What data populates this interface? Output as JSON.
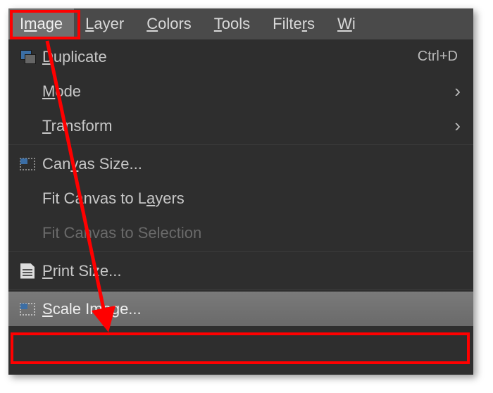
{
  "menubar": {
    "image": {
      "pre": "I",
      "ul": "m",
      "post": "age"
    },
    "layer": {
      "pre": "",
      "ul": "L",
      "post": "ayer"
    },
    "colors": {
      "pre": "",
      "ul": "C",
      "post": "olors"
    },
    "tools": {
      "pre": "",
      "ul": "T",
      "post": "ools"
    },
    "filters": {
      "pre": "Filte",
      "ul": "r",
      "post": "s"
    },
    "windows": {
      "pre": "",
      "ul": "W",
      "post": "i"
    }
  },
  "menu": {
    "duplicate": {
      "pre": "",
      "ul": "D",
      "post": "uplicate",
      "accel": "Ctrl+D"
    },
    "mode": {
      "pre": "",
      "ul": "M",
      "post": "ode"
    },
    "transform": {
      "pre": "",
      "ul": "T",
      "post": "ransform"
    },
    "canvas_size": {
      "pre": "Can",
      "ul": "v",
      "post": "as Size..."
    },
    "fit_layers": {
      "pre": "Fit Canvas to L",
      "ul": "a",
      "post": "yers"
    },
    "fit_selection": {
      "pre": "Fit Canvas to Selection",
      "ul": "",
      "post": ""
    },
    "print_size": {
      "pre": "",
      "ul": "P",
      "post": "rint Size..."
    },
    "scale_image": {
      "pre": "",
      "ul": "S",
      "post": "cale Image..."
    }
  }
}
